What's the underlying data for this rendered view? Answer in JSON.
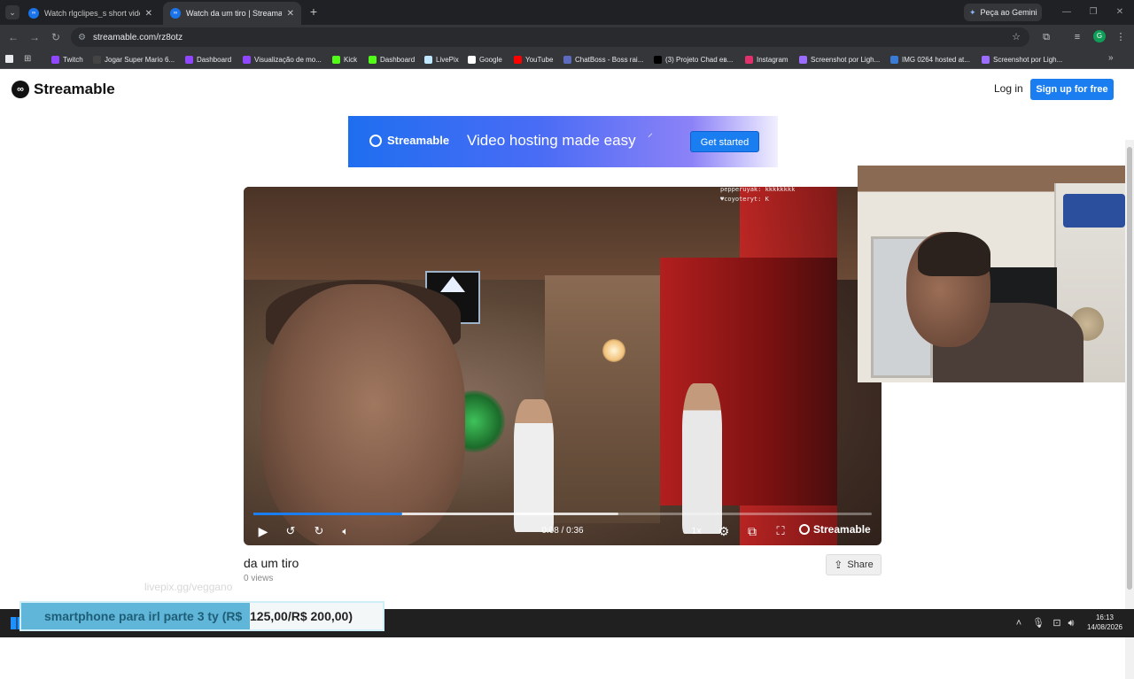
{
  "browser": {
    "tabs": [
      {
        "title": "Watch rlgclipes_s short video w",
        "active": false
      },
      {
        "title": "Watch da um tiro | Streamable",
        "active": true
      }
    ],
    "gemini_label": "Peça ao Gemini",
    "url": "streamable.com/rz8otz",
    "profile_initial": "G",
    "bookmarks": [
      {
        "label": "Twitch",
        "color": "#9146ff"
      },
      {
        "label": "Jogar Super Mario 6...",
        "color": "#444444"
      },
      {
        "label": "Dashboard",
        "color": "#9146ff"
      },
      {
        "label": "Visualização de mo...",
        "color": "#9146ff"
      },
      {
        "label": "Kick",
        "color": "#53fc18"
      },
      {
        "label": "Dashboard",
        "color": "#53fc18"
      },
      {
        "label": "LivePix",
        "color": "#bfe7ff"
      },
      {
        "label": "Google",
        "color": "#ffffff"
      },
      {
        "label": "YouTube",
        "color": "#ff0000"
      },
      {
        "label": "ChatBoss - Boss rai...",
        "color": "#5c6bc0"
      },
      {
        "label": "(3) Projeto Chad ев...",
        "color": "#000000"
      },
      {
        "label": "Instagram",
        "color": "#e1306c"
      },
      {
        "label": "Screenshot por Ligh...",
        "color": "#9c6bff"
      },
      {
        "label": "IMG 0264 hosted at...",
        "color": "#3a7bd5"
      },
      {
        "label": "Screenshot por Ligh...",
        "color": "#9c6bff"
      }
    ]
  },
  "site": {
    "logo_text": "Streamable",
    "login_label": "Log in",
    "signup_label": "Sign up for free",
    "banner": {
      "logo_text": "Streamable",
      "tagline": "Video hosting made easy",
      "cta_label": "Get started"
    }
  },
  "player": {
    "timecode": "0:08 / 0:36",
    "speed_label": "1x",
    "brand_label": "Streamable",
    "played_fraction": 0.24,
    "buffered_fraction": 0.59,
    "chat_lines": [
      "pepperuyak: kkkkkkkk",
      "♥coyoteryt: K"
    ]
  },
  "video": {
    "title": "da um tiro",
    "views": "0 views",
    "share_label": "Share"
  },
  "stream_overlay": {
    "url_watermark": "livepix.gg/veggano",
    "alert_text": "smartphone para irl parte 3 ty (R$ ",
    "alert_amount": "125,00/R$ 200,00)"
  },
  "taskbar": {
    "time": "16:13",
    "date": "14/08/2026"
  }
}
